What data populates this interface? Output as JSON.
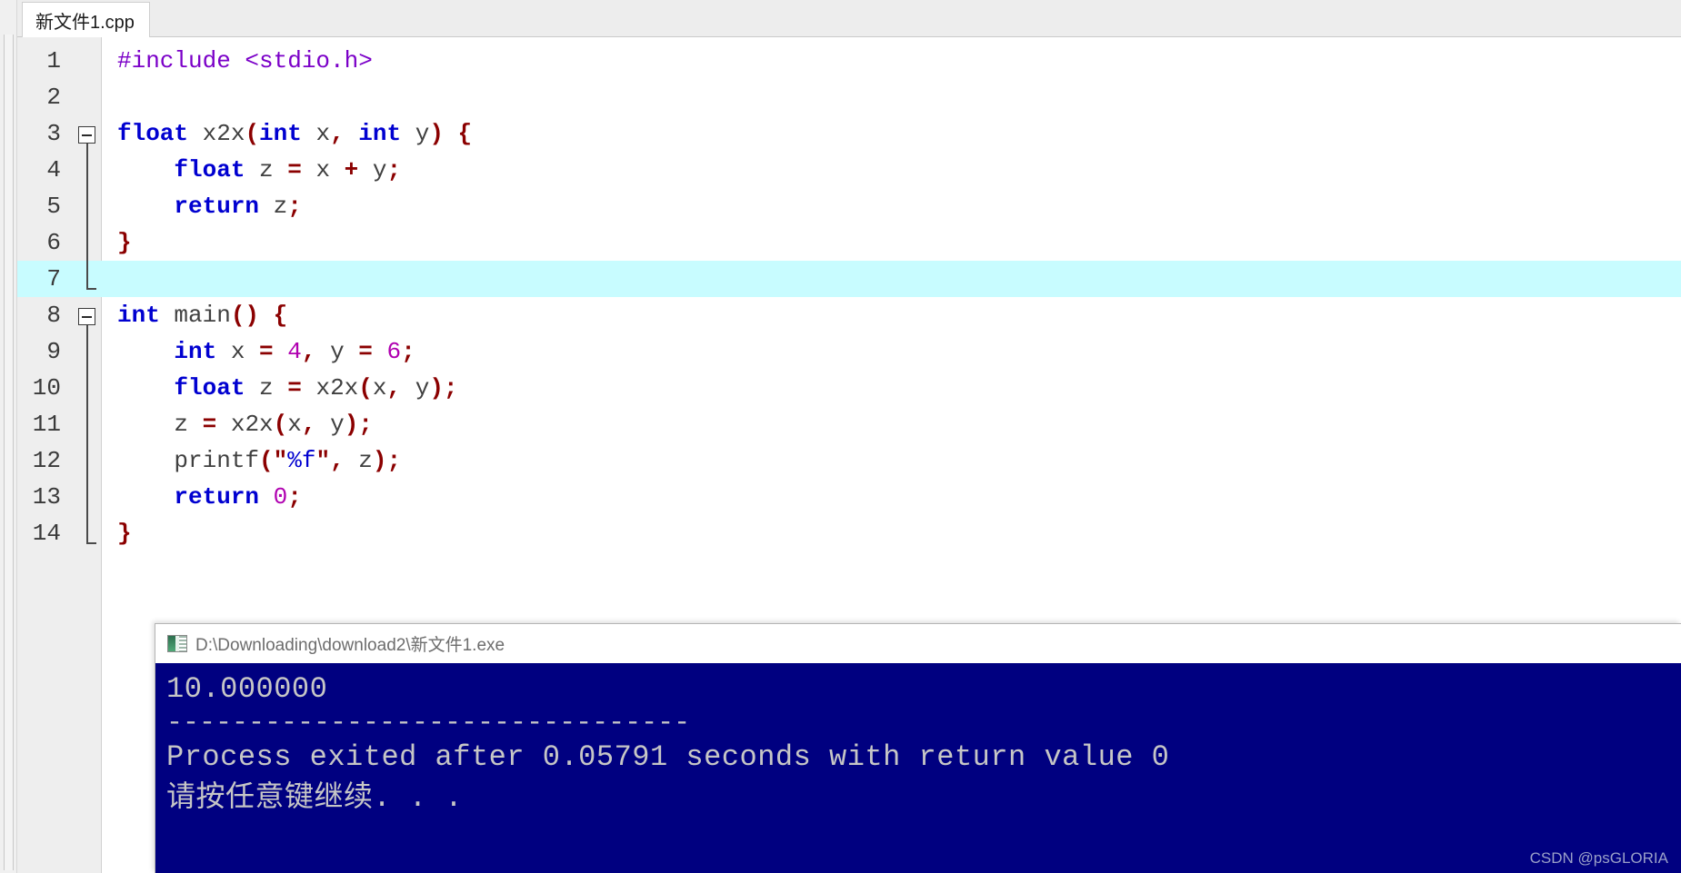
{
  "window": {
    "app": "Dev-C++ editor",
    "background_color": "#ffffff"
  },
  "tabbar": {
    "tabs": [
      {
        "label": "新文件1.cpp",
        "active": true
      }
    ]
  },
  "editor": {
    "current_line": 7,
    "current_line_color": "#c8fcff",
    "gutter_color": "#eeeeee",
    "colors": {
      "keyword": "#0000d0",
      "preprocessor": "#7b00c8",
      "number": "#b000b0",
      "punctuation": "#8b0000",
      "string": "#8b0000",
      "identifier": "#404040"
    },
    "lines": [
      {
        "n": "1",
        "text": "#include <stdio.h>"
      },
      {
        "n": "2",
        "text": ""
      },
      {
        "n": "3",
        "text": "float x2x(int x, int y) {"
      },
      {
        "n": "4",
        "text": "    float z = x + y;"
      },
      {
        "n": "5",
        "text": "    return z;"
      },
      {
        "n": "6",
        "text": "}"
      },
      {
        "n": "7",
        "text": ""
      },
      {
        "n": "8",
        "text": "int main() {"
      },
      {
        "n": "9",
        "text": "    int x = 4, y = 6;"
      },
      {
        "n": "10",
        "text": "    float z = x2x(x, y);"
      },
      {
        "n": "11",
        "text": "    z = x2x(x, y);"
      },
      {
        "n": "12",
        "text": "    printf(\"%f\", z);"
      },
      {
        "n": "13",
        "text": "    return 0;"
      },
      {
        "n": "14",
        "text": "}"
      }
    ],
    "fold_markers": [
      {
        "line": 3,
        "collapsible": true
      },
      {
        "line": 8,
        "collapsible": true
      }
    ]
  },
  "console": {
    "title": "D:\\Downloading\\download2\\新文件1.exe",
    "icon": "console-app-icon",
    "background_color": "#000080",
    "text_color": "#c6c6c6",
    "output_lines": [
      "10.000000",
      "--------------------------------",
      "Process exited after 0.05791 seconds with return value 0",
      "请按任意键继续. . ."
    ]
  },
  "watermark": {
    "text": "CSDN @psGLORIA"
  }
}
